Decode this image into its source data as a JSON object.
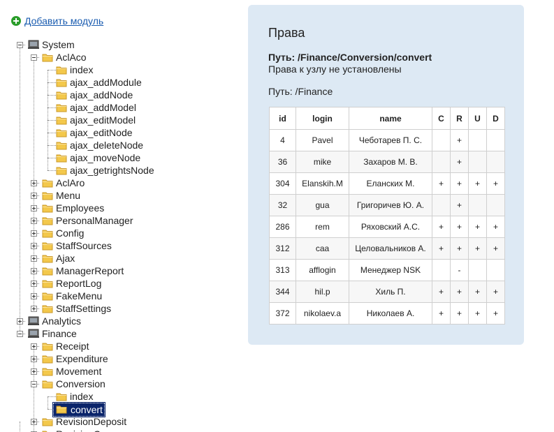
{
  "add_module": {
    "label": "Добавить модуль"
  },
  "tree": [
    {
      "label": "System",
      "depth": 0,
      "type": "module",
      "expanded": true
    },
    {
      "label": "AclAco",
      "depth": 1,
      "type": "folder",
      "expanded": true
    },
    {
      "label": "index",
      "depth": 2,
      "type": "folder"
    },
    {
      "label": "ajax_addModule",
      "depth": 2,
      "type": "folder"
    },
    {
      "label": "ajax_addNode",
      "depth": 2,
      "type": "folder"
    },
    {
      "label": "ajax_addModel",
      "depth": 2,
      "type": "folder"
    },
    {
      "label": "ajax_editModel",
      "depth": 2,
      "type": "folder"
    },
    {
      "label": "ajax_editNode",
      "depth": 2,
      "type": "folder"
    },
    {
      "label": "ajax_deleteNode",
      "depth": 2,
      "type": "folder"
    },
    {
      "label": "ajax_moveNode",
      "depth": 2,
      "type": "folder"
    },
    {
      "label": "ajax_getrightsNode",
      "depth": 2,
      "type": "folder"
    },
    {
      "label": "AclAro",
      "depth": 1,
      "type": "folder",
      "expanded": false
    },
    {
      "label": "Menu",
      "depth": 1,
      "type": "folder",
      "expanded": false
    },
    {
      "label": "Employees",
      "depth": 1,
      "type": "folder",
      "expanded": false
    },
    {
      "label": "PersonalManager",
      "depth": 1,
      "type": "folder",
      "expanded": false
    },
    {
      "label": "Config",
      "depth": 1,
      "type": "folder",
      "expanded": false
    },
    {
      "label": "StaffSources",
      "depth": 1,
      "type": "folder",
      "expanded": false
    },
    {
      "label": "Ajax",
      "depth": 1,
      "type": "folder",
      "expanded": false
    },
    {
      "label": "ManagerReport",
      "depth": 1,
      "type": "folder",
      "expanded": false
    },
    {
      "label": "ReportLog",
      "depth": 1,
      "type": "folder",
      "expanded": false
    },
    {
      "label": "FakeMenu",
      "depth": 1,
      "type": "folder",
      "expanded": false
    },
    {
      "label": "StaffSettings",
      "depth": 1,
      "type": "folder",
      "expanded": false
    },
    {
      "label": "Analytics",
      "depth": 0,
      "type": "module",
      "expanded": false
    },
    {
      "label": "Finance",
      "depth": 0,
      "type": "module",
      "expanded": true
    },
    {
      "label": "Receipt",
      "depth": 1,
      "type": "folder",
      "expanded": false
    },
    {
      "label": "Expenditure",
      "depth": 1,
      "type": "folder",
      "expanded": false
    },
    {
      "label": "Movement",
      "depth": 1,
      "type": "folder",
      "expanded": false
    },
    {
      "label": "Conversion",
      "depth": 1,
      "type": "folder",
      "expanded": true
    },
    {
      "label": "index",
      "depth": 2,
      "type": "folder"
    },
    {
      "label": "convert",
      "depth": 2,
      "type": "folder",
      "selected": true
    },
    {
      "label": "RevisionDeposit",
      "depth": 1,
      "type": "folder",
      "expanded": false
    },
    {
      "label": "RevisionCr",
      "depth": 1,
      "type": "folder",
      "expanded": false
    }
  ],
  "panel": {
    "title": "Права",
    "path_label": "Путь: /Finance/Conversion/convert",
    "no_rights": "Права к узлу не установлены",
    "parent_path": "Путь: /Finance",
    "columns": [
      "id",
      "login",
      "name",
      "C",
      "R",
      "U",
      "D"
    ],
    "rows": [
      [
        "4",
        "Pavel",
        "Чеботарев П. С.",
        "",
        "+",
        "",
        ""
      ],
      [
        "36",
        "mike",
        "Захаров М. В.",
        "",
        "+",
        "",
        ""
      ],
      [
        "304",
        "Elanskih.M",
        "Еланских М.",
        "+",
        "+",
        "+",
        "+"
      ],
      [
        "32",
        "gua",
        "Григоричев Ю. А.",
        "",
        "+",
        "",
        ""
      ],
      [
        "286",
        "rem",
        "Ряховский А.С.",
        "+",
        "+",
        "+",
        "+"
      ],
      [
        "312",
        "caa",
        "Целовальников А.",
        "+",
        "+",
        "+",
        "+"
      ],
      [
        "313",
        "afflogin",
        "Менеджер NSK",
        "",
        "-",
        "",
        ""
      ],
      [
        "344",
        "hil.p",
        "Хиль П.",
        "+",
        "+",
        "+",
        "+"
      ],
      [
        "372",
        "nikolaev.a",
        "Николаев А.",
        "+",
        "+",
        "+",
        "+"
      ]
    ]
  },
  "colors": {
    "panel_bg": "#dde9f4",
    "link": "#1a5cb0",
    "selected_bg": "#0a246a",
    "folder": "#f3c84b",
    "add_icon": "#2a9d2a"
  }
}
